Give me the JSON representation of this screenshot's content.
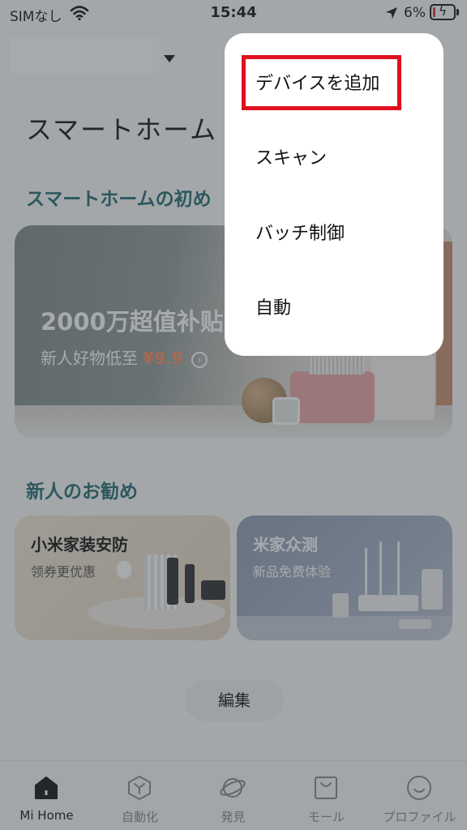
{
  "status_bar": {
    "carrier": "SIMなし",
    "time": "15:44",
    "battery": "6%",
    "wifi_icon": "wifi-icon",
    "location_icon": "location-arrow-icon",
    "battery_icon": "battery-charging-icon"
  },
  "header": {
    "home_name": "",
    "page_title": "スマートホーム"
  },
  "sections": {
    "beginner": "スマートホームの初め",
    "recommend": "新人のお勧め"
  },
  "banner": {
    "title": "2000万超值补贴",
    "subtitle_prefix": "新人好物低至",
    "price": "¥9.9",
    "arrow": "›"
  },
  "cards": [
    {
      "title": "小米家装安防",
      "subtitle": "领券更优惠"
    },
    {
      "title": "米家众测",
      "subtitle": "新品免费体验"
    }
  ],
  "edit_label": "編集",
  "nav": [
    {
      "label": "Mi Home",
      "icon": "home-icon",
      "active": true
    },
    {
      "label": "自動化",
      "icon": "automation-icon",
      "active": false
    },
    {
      "label": "発見",
      "icon": "planet-icon",
      "active": false
    },
    {
      "label": "モール",
      "icon": "shopping-bag-icon",
      "active": false
    },
    {
      "label": "プロファイル",
      "icon": "smiley-profile-icon",
      "active": false
    }
  ],
  "menu": {
    "items": [
      {
        "label": "デバイスを追加",
        "highlighted": true
      },
      {
        "label": "スキャン"
      },
      {
        "label": "バッチ制御"
      },
      {
        "label": "自動"
      }
    ],
    "highlight_color": "#e01020"
  },
  "colors": {
    "section_heading": "#1f6b73",
    "price_accent": "#ff8a5c"
  }
}
